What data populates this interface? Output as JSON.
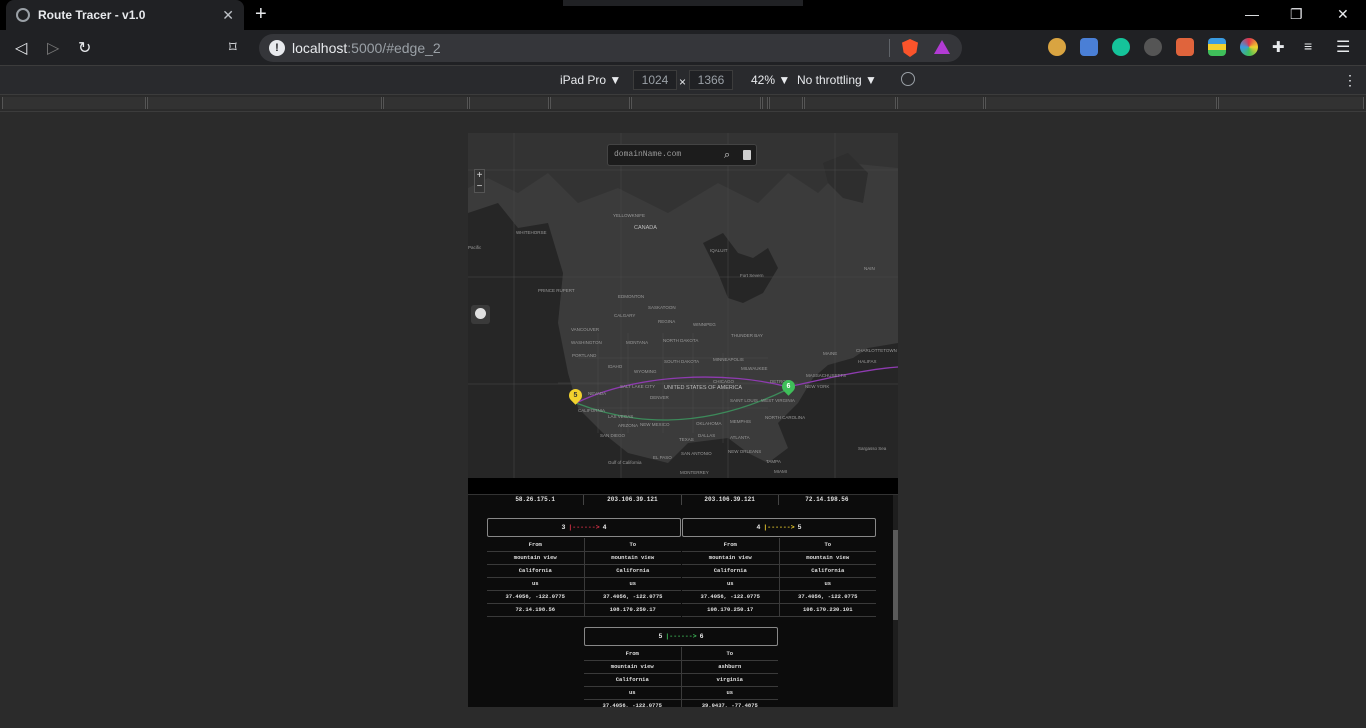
{
  "browser": {
    "tab_title": "Route Tracer - v1.0",
    "tab_close": "✕",
    "new_tab": "+",
    "url_host": "localhost",
    "url_rest": ":5000/#edge_2",
    "win_minimize": "—",
    "win_restore": "❐",
    "win_close": "✕"
  },
  "devtools": {
    "device": "iPad Pro ▼",
    "width": "1024",
    "times": "×",
    "height": "1366",
    "zoom": "42% ▼",
    "throttle": "No throttling ▼"
  },
  "map": {
    "search_placeholder": "domainName.com",
    "zoom_in": "+",
    "zoom_out": "−",
    "labels": {
      "canada": "CANADA",
      "usa": "UNITED STATES OF AMERICA",
      "yellowknife": "YELLOWKNIFE",
      "whitehorse": "WHITEHORSE",
      "iqaluit": "IQALUIT",
      "fort_severn": "Fort Severn",
      "nain": "NAIN",
      "prince_rupert": "PRINCE RUPERT",
      "edmonton": "EDMONTON",
      "saskatoon": "SASKATOON",
      "calgary": "CALGARY",
      "regina": "REGINA",
      "winnipeg": "WINNIPEG",
      "thunder_bay": "THUNDER BAY",
      "vancouver": "VANCOUVER",
      "seattle": "WASHINGTON",
      "montana": "MONTANA",
      "north_dakota": "NORTH DAKOTA",
      "portland": "PORTLAND",
      "south_dakota": "SOUTH DAKOTA",
      "minneapolis": "MINNEAPOLIS",
      "idaho": "IDAHO",
      "wyoming": "WYOMING",
      "milwaukee": "MILWAUKEE",
      "detroit": "DETROIT",
      "halifax": "HALIFAX",
      "charlottetown": "CHARLOTTETOWN",
      "maine": "MAINE",
      "massachusetts": "MASSACHUSETTS",
      "new_york": "NEW YORK",
      "nevada": "NEVADA",
      "salt_lake": "SALT LAKE CITY",
      "denver": "DENVER",
      "chicago": "CHICAGO",
      "california": "CALIFORNIA",
      "las_vegas": "LAS VEGAS",
      "saint_louis": "SAINT LOUIS",
      "west_virginia": "WEST VIRGINIA",
      "arizona": "ARIZONA",
      "new_mexico": "NEW MEXICO",
      "oklahoma": "OKLAHOMA",
      "memphis": "MEMPHIS",
      "north_carolina": "NORTH CAROLINA",
      "san_diego": "SAN DIEGO",
      "dallas": "DALLAS",
      "texas": "TEXAS",
      "atlanta": "ATLANTA",
      "el_paso": "EL PASO",
      "new_orleans": "NEW ORLEANS",
      "chihuahua": "CHIHUAHUA",
      "san_antonio": "SAN ANTONIO",
      "tampa": "TAMPA",
      "gulf": "Gulf of California",
      "monterrey": "MONTERREY",
      "miami": "MIAMI",
      "sargasso": "Sargasso Sea",
      "pacific": "Pacific"
    },
    "markers": [
      {
        "label": "5",
        "color": "#f2d22e"
      },
      {
        "label": "6",
        "color": "#3fbf5a"
      }
    ],
    "route_colors": {
      "edge_purple": "#8e3bb0",
      "edge_green": "#3c8a5a"
    }
  },
  "panel": {
    "top_row": [
      "58.26.175.1",
      "203.106.39.121",
      "203.106.39.121",
      "72.14.198.56"
    ],
    "edges": [
      {
        "from_node": "3",
        "arrow": "|------>",
        "arrow_color": "#e0334a",
        "to_node": "4",
        "rows": [
          [
            "From",
            "To"
          ],
          [
            "mountain view",
            "mountain view"
          ],
          [
            "California",
            "California"
          ],
          [
            "us",
            "us"
          ],
          [
            "37.4056, -122.0775",
            "37.4056, -122.0775"
          ],
          [
            "72.14.198.56",
            "108.170.250.17"
          ]
        ]
      },
      {
        "from_node": "4",
        "arrow": "|------>",
        "arrow_color": "#f2d22e",
        "to_node": "5",
        "rows": [
          [
            "From",
            "To"
          ],
          [
            "mountain view",
            "mountain view"
          ],
          [
            "California",
            "California"
          ],
          [
            "us",
            "us"
          ],
          [
            "37.4056, -122.0775",
            "37.4056, -122.0775"
          ],
          [
            "108.170.250.17",
            "108.170.230.101"
          ]
        ]
      },
      {
        "from_node": "5",
        "arrow": "|------>",
        "arrow_color": "#3fbf5a",
        "to_node": "6",
        "rows": [
          [
            "From",
            "To"
          ],
          [
            "mountain view",
            "ashburn"
          ],
          [
            "California",
            "virginia"
          ],
          [
            "us",
            "us"
          ],
          [
            "37.4056, -122.0775",
            "39.0437, -77.4875"
          ]
        ]
      }
    ]
  }
}
